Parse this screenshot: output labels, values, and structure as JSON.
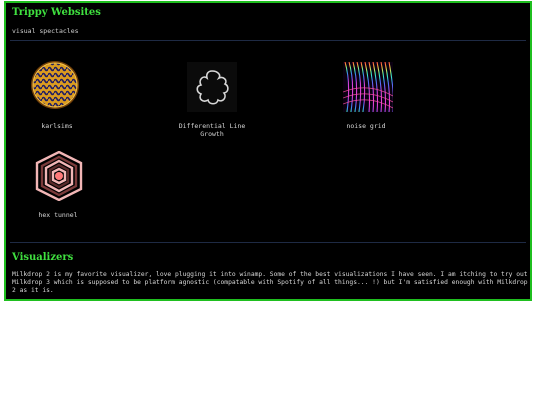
{
  "websites": {
    "title": "Trippy Websites",
    "subtitle": "visual spectacles",
    "items": [
      {
        "caption": "karlsims",
        "icon": "karlsims-thumbnail"
      },
      {
        "caption": "Differential Line Growth",
        "icon": "line-growth-thumbnail"
      },
      {
        "caption": "noise grid",
        "icon": "noise-grid-thumbnail"
      },
      {
        "caption": "hex tunnel",
        "icon": "hex-tunnel-thumbnail"
      }
    ]
  },
  "visualizers": {
    "title": "Visualizers",
    "text": "Milkdrop 2 is my favorite visualizer, love plugging it into winamp. Some of the best visualizations I have seen. I am itching to try out Milkdrop 3 which is supposed to be platform agnostic (compatable with Spotify of all things... !) but I'm satisfied enough with Milkdrop 2 as it is."
  },
  "colors": {
    "accent": "#3fe03f",
    "border": "#1fbf1f",
    "background": "#000000"
  }
}
